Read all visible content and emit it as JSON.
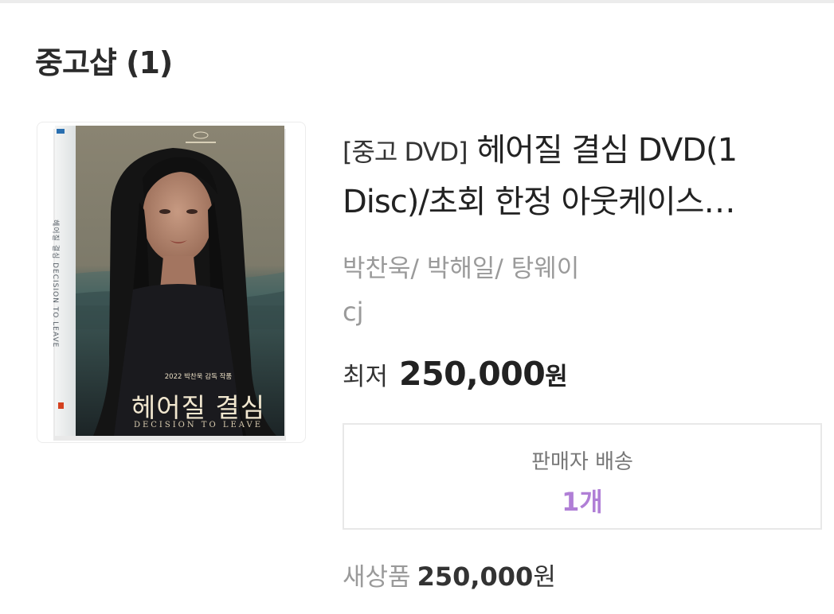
{
  "section": {
    "title": "중고샵 (1)"
  },
  "product": {
    "cover": {
      "title_ko": "헤어질 결심",
      "title_en": "DECISION TO LEAVE",
      "credit": "2022 박찬욱 감독 작품",
      "spine_text": "헤어질 결심  DECISION TO LEAVE"
    },
    "title_tag": "[중고 DVD]",
    "title_line1_rest": " 헤어질 결심 DVD(1",
    "title_line2": "Disc)/초회 한정 아웃케이스…",
    "authors": "박찬욱/ 박해일/ 탕웨이",
    "publisher": "cj",
    "lowest_label": "최저",
    "lowest_price": "250,000",
    "lowest_unit": "원"
  },
  "seller_box": {
    "label": "판매자 배송",
    "count": "1개",
    "count_color": "#b07fd6"
  },
  "new_item": {
    "label": "새상품",
    "price": "250,000",
    "unit": "원"
  }
}
